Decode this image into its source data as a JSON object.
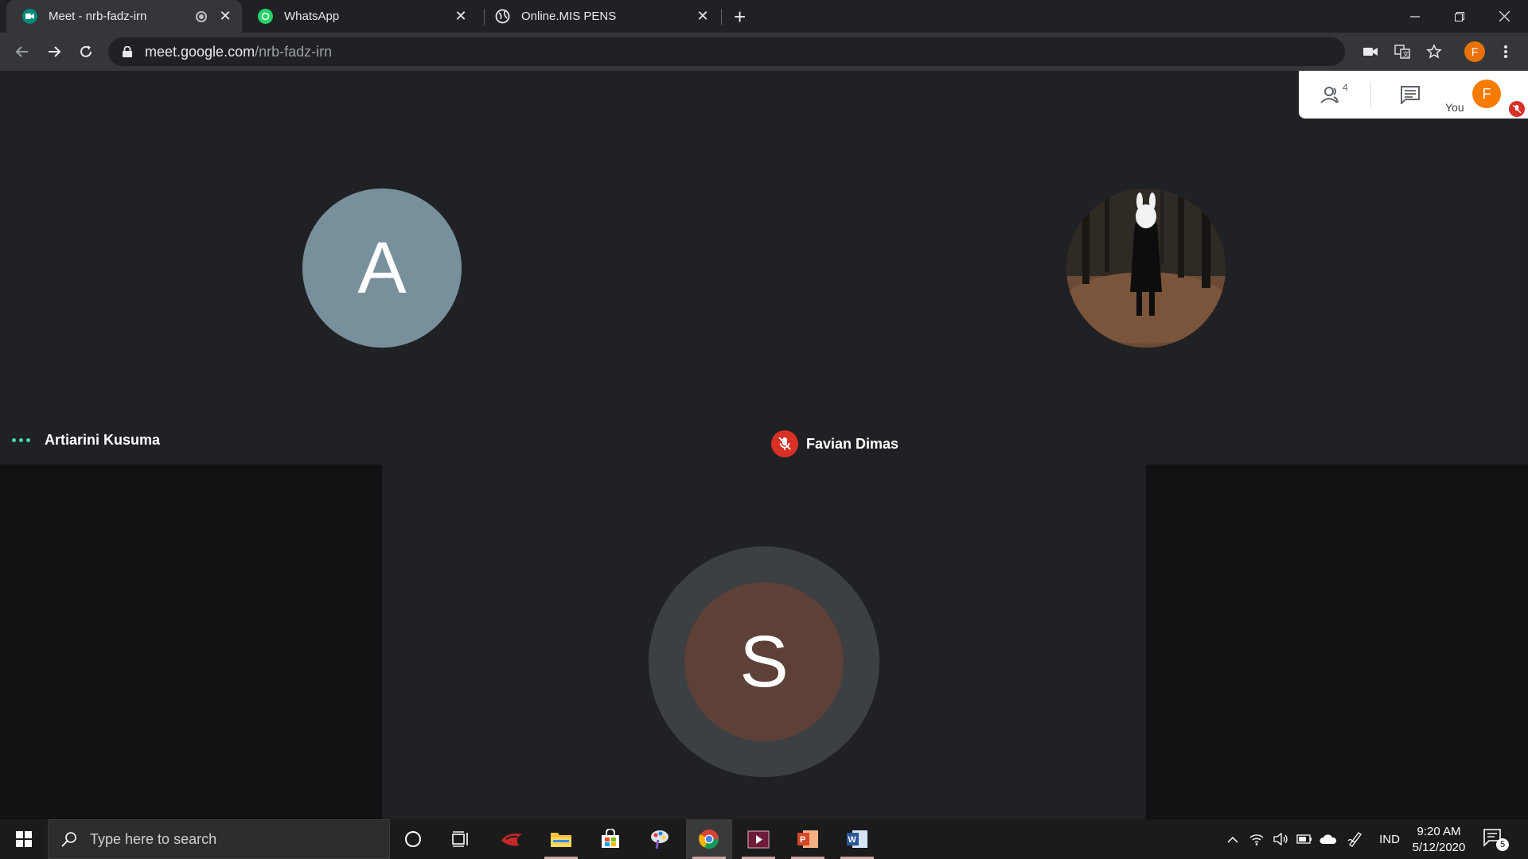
{
  "browser": {
    "tabs": [
      {
        "label": "Meet - nrb-fadz-irn",
        "favicon": "google-meet-icon",
        "active": true,
        "recording": true
      },
      {
        "label": "WhatsApp",
        "favicon": "whatsapp-icon",
        "active": false
      },
      {
        "label": "Online.MIS PENS",
        "favicon": "globe-icon",
        "active": false
      }
    ],
    "url_host": "meet.google.com",
    "url_path": "/nrb-fadz-irn",
    "profile_initial": "F"
  },
  "meet": {
    "participants": [
      {
        "name": "Artiarini Kusuma",
        "initial": "A",
        "avatar_color": "#78909c",
        "speaking": true,
        "muted": false
      },
      {
        "name": "Favian Dimas",
        "initial": "",
        "avatar_type": "photo",
        "muted": true
      },
      {
        "name": "",
        "initial": "S",
        "avatar_color": "#5d4037",
        "muted": false
      }
    ],
    "people_count": "4",
    "you_label": "You",
    "you_initial": "F",
    "you_avatar_color": "#f57c00"
  },
  "taskbar": {
    "search_placeholder": "Type here to search",
    "language": "IND",
    "time": "9:20 AM",
    "date": "5/12/2020",
    "notification_count": "5"
  },
  "colors": {
    "meet_background": "#202124",
    "muted_red": "#d93025",
    "speaking_teal": "#4cd7b0"
  }
}
